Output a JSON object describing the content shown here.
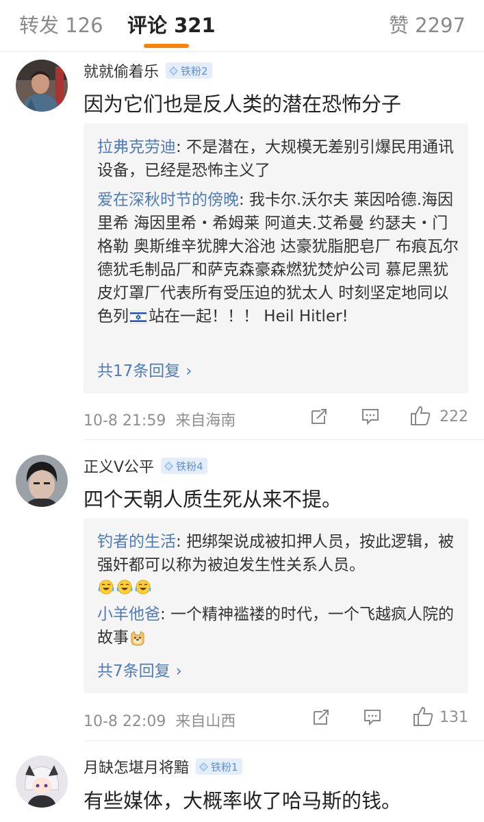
{
  "tabs": {
    "repost": "转发 126",
    "comments": "评论 321",
    "likes": "赞 2297"
  },
  "badge_color": "#5f8fd7",
  "accent_color": "#ff8200",
  "link_color": "#4f7bbb",
  "comments": [
    {
      "username": "就就偷着乐",
      "badge": "铁粉2",
      "text": "因为它们也是反人类的潜在恐怖分子",
      "replies": [
        {
          "author": "拉弗克劳迪",
          "text": ": 不是潜在，大规模无差别引爆民用通讯设备，已经是恐怖主义了"
        },
        {
          "author": "爱在深秋时节的傍晚",
          "text_before_flag": ": 我卡尔.沃尔夫  莱因哈德.海因里希   海因里希・希姆莱  阿道夫.艾希曼  约瑟夫・门格勒  奥斯维辛犹脾大浴池  达豪犹脂肥皂厂  布痕瓦尔德犹毛制品厂和萨克森豪森燃犹焚炉公司  慕尼黑犹皮灯罩厂代表所有受压迫的犹太人  时刻坚定地同以色列",
          "flag_icon": "israel-flag-emoji",
          "text_after_flag": "站在一起！！！ Heil Hitler!"
        }
      ],
      "more_replies": "共17条回复",
      "time": "10-8 21:59",
      "location": "来自海南",
      "likes": "222"
    },
    {
      "username": "正义V公平",
      "badge": "铁粉4",
      "text": "四个天朝人质生死从来不提。",
      "replies": [
        {
          "author": "钓者的生活",
          "text": ": 把绑架说成被扣押人员，按此逻辑，被强奸都可以称为被迫发生性关系人员。",
          "emoji": "laughing-crying-emoji"
        },
        {
          "author": "小羊他爸",
          "text": ": 一个精神褴褛的时代，一个飞越疯人院的故事",
          "emoji": "doge-emoji"
        }
      ],
      "more_replies": "共7条回复",
      "time": "10-8 22:09",
      "location": "来自山西",
      "likes": "131"
    },
    {
      "username": "月缺怎堪月将黯",
      "badge": "铁粉1",
      "text": "有些媒体，大概率收了哈马斯的钱。"
    }
  ]
}
